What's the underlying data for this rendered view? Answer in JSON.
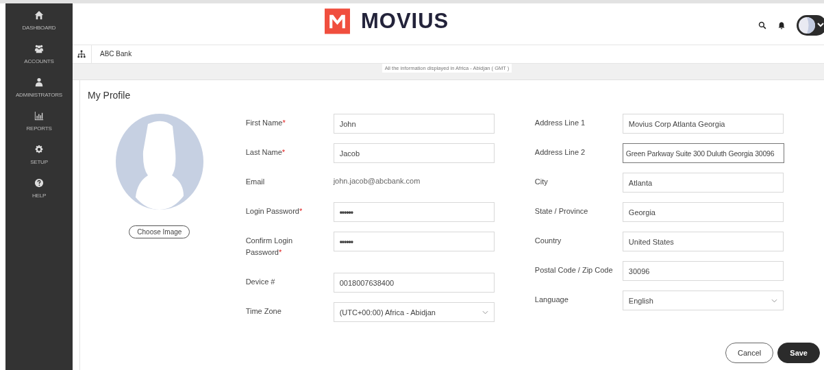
{
  "sidebar": {
    "items": [
      {
        "label": "DASHBOARD"
      },
      {
        "label": "ACCOUNTS"
      },
      {
        "label": "ADMINISTRATORS"
      },
      {
        "label": "REPORTS"
      },
      {
        "label": "SETUP"
      },
      {
        "label": "HELP"
      }
    ]
  },
  "header": {
    "brand": "MOVIUS"
  },
  "breadcrumb": "ABC Bank",
  "timezone_note": "All the information displayed in Africa - Abidjan ( GMT )",
  "profile": {
    "title": "My Profile",
    "choose_image": "Choose Image",
    "left_fields": [
      {
        "label": "First Name",
        "required_mark": "*",
        "kind": "text",
        "value": "John"
      },
      {
        "label": "Last Name",
        "required_mark": "*",
        "kind": "text",
        "value": "Jacob"
      },
      {
        "label": "Email",
        "kind": "static",
        "value": "john.jacob@abcbank.com"
      },
      {
        "label": "Login Password",
        "required_mark": "*",
        "kind": "password",
        "value": "••••••"
      },
      {
        "label": "Confirm Login Password",
        "required_mark": "*",
        "kind": "password",
        "value": "••••••"
      },
      {
        "label": "Device #",
        "kind": "text",
        "value": "0018007638400"
      },
      {
        "label": "Time Zone",
        "kind": "select",
        "value": "(UTC+00:00) Africa - Abidjan"
      }
    ],
    "right_fields": [
      {
        "label": "Address Line 1",
        "kind": "text",
        "value": "Movius Corp Atlanta Georgia"
      },
      {
        "label": "Address Line 2",
        "kind": "text",
        "value": "Green Parkway Suite 300 Duluth Georgia 30096",
        "focused": true
      },
      {
        "label": "City",
        "kind": "text",
        "value": "Atlanta"
      },
      {
        "label": "State / Province",
        "kind": "text",
        "value": "Georgia"
      },
      {
        "label": "Country",
        "kind": "text",
        "value": "United States"
      },
      {
        "label": "Postal Code / Zip Code",
        "kind": "text",
        "value": "30096"
      },
      {
        "label": "Language",
        "kind": "select",
        "value": "English"
      }
    ]
  },
  "buttons": {
    "cancel": "Cancel",
    "save": "Save"
  }
}
